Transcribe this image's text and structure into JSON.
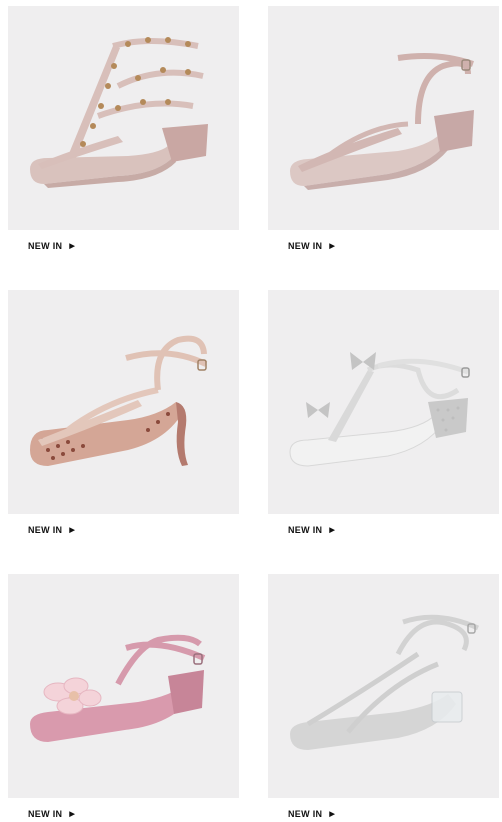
{
  "products": [
    {
      "label": "NEW IN",
      "icon": "triangle-right-icon",
      "image": "nude-studded-strappy-block-heel-sandal"
    },
    {
      "label": "NEW IN",
      "icon": "triangle-right-icon",
      "image": "nude-ankle-strap-block-heel-sandal"
    },
    {
      "label": "NEW IN",
      "icon": "triangle-right-icon",
      "image": "nude-perforated-kitten-heel-sandal"
    },
    {
      "label": "NEW IN",
      "icon": "triangle-right-icon",
      "image": "silver-bow-t-strap-block-heel-sandal"
    },
    {
      "label": "NEW IN",
      "icon": "triangle-right-icon",
      "image": "pink-flower-ankle-strap-sandal"
    },
    {
      "label": "NEW IN",
      "icon": "triangle-right-icon",
      "image": "silver-glitter-clear-heel-sandal"
    }
  ],
  "arrow_glyph": "▶",
  "colors": {
    "image_bg": "#efeeef",
    "text": "#111111"
  }
}
